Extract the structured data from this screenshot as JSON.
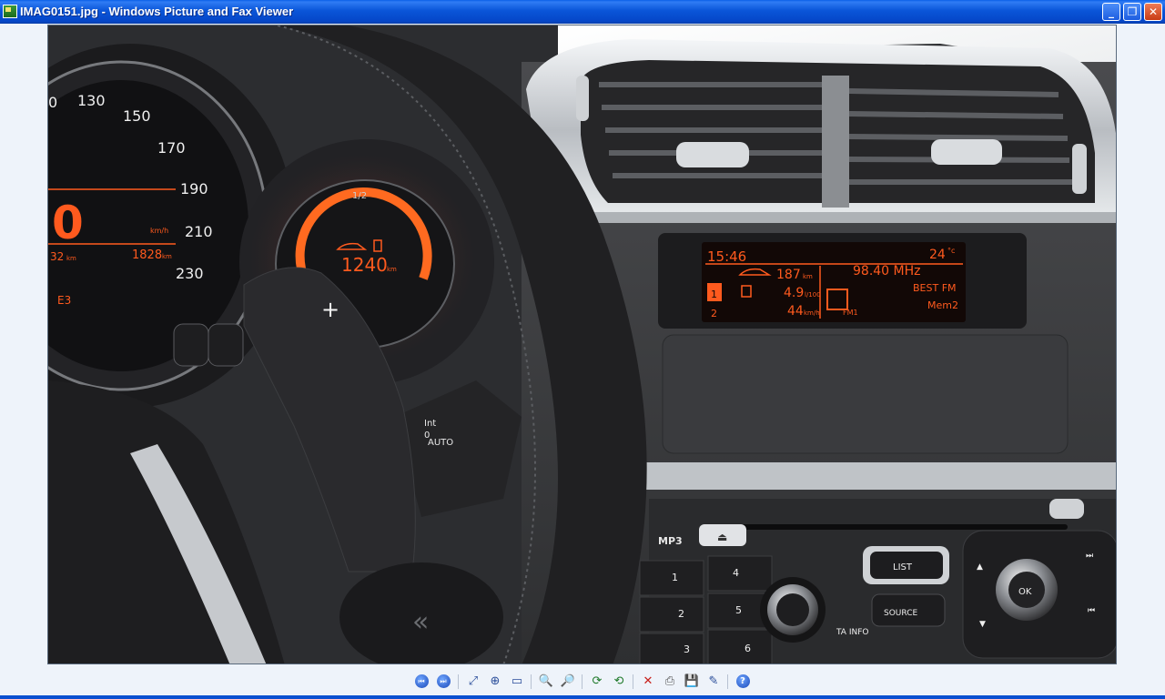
{
  "window": {
    "title": "IMAG0151.jpg - Windows Picture and Fax Viewer",
    "minimize_glyph": "_",
    "restore_glyph": "❐",
    "close_glyph": "✕"
  },
  "photo": {
    "speedo_ticks": [
      "0",
      "130",
      "150",
      "170",
      "190",
      "210",
      "230"
    ],
    "speed": "0",
    "speed_unit": "km/h",
    "trip_left": "32",
    "trip_left_unit": "km",
    "odometer": "1828",
    "odometer_unit": "km",
    "gear_code": "E3",
    "fuel_half_label": "1/2",
    "range_value": "1240",
    "range_unit": "km",
    "paddle_symbol": "+",
    "stalk_labels": [
      "Int",
      "0",
      "AUTO"
    ],
    "display": {
      "clock": "15:46",
      "temperature": "24",
      "temp_unit": "°c",
      "trip_distance": "187",
      "trip_distance_unit": "km",
      "consumption": "4.9",
      "consumption_unit": "l/100",
      "avg_speed": "44",
      "avg_speed_unit": "km/h",
      "frequency": "98.40 MHz",
      "station": "BEST FM",
      "band": "FM1",
      "memory": "Mem2",
      "trip_one": "1",
      "trip_two": "2"
    },
    "radio": {
      "mp3_label": "MP3",
      "list_label": "LIST",
      "source_label": "SOURCE",
      "ok_label": "OK",
      "ta_info_label": "TA\nINFO",
      "preset_keys": [
        "1",
        "4",
        "2",
        "5",
        "3",
        "6"
      ]
    }
  },
  "toolbar": {
    "buttons": [
      {
        "name": "previous-image-button",
        "glyph": "⏮",
        "circle": true
      },
      {
        "name": "next-image-button",
        "glyph": "⏭",
        "circle": true
      },
      {
        "name": "best-fit-button",
        "glyph": "⤢"
      },
      {
        "name": "actual-size-button",
        "glyph": "⊕"
      },
      {
        "name": "slideshow-button",
        "glyph": "▭"
      },
      {
        "name": "zoom-in-button",
        "glyph": "🔍"
      },
      {
        "name": "zoom-out-button",
        "glyph": "🔎"
      },
      {
        "name": "rotate-clockwise-button",
        "glyph": "⟳"
      },
      {
        "name": "rotate-counterclockwise-button",
        "glyph": "⟲"
      },
      {
        "name": "delete-button",
        "glyph": "✕"
      },
      {
        "name": "print-button",
        "glyph": "⎙"
      },
      {
        "name": "save-button",
        "glyph": "💾"
      },
      {
        "name": "edit-button",
        "glyph": "✎"
      },
      {
        "name": "help-button",
        "glyph": "?",
        "circle": true
      }
    ]
  },
  "colors": {
    "titlebar": "#0a55d8",
    "lcd_orange": "#ff5a1e",
    "dash_plastic": "#3b3c3f",
    "chrome": "#c8cbcf"
  }
}
